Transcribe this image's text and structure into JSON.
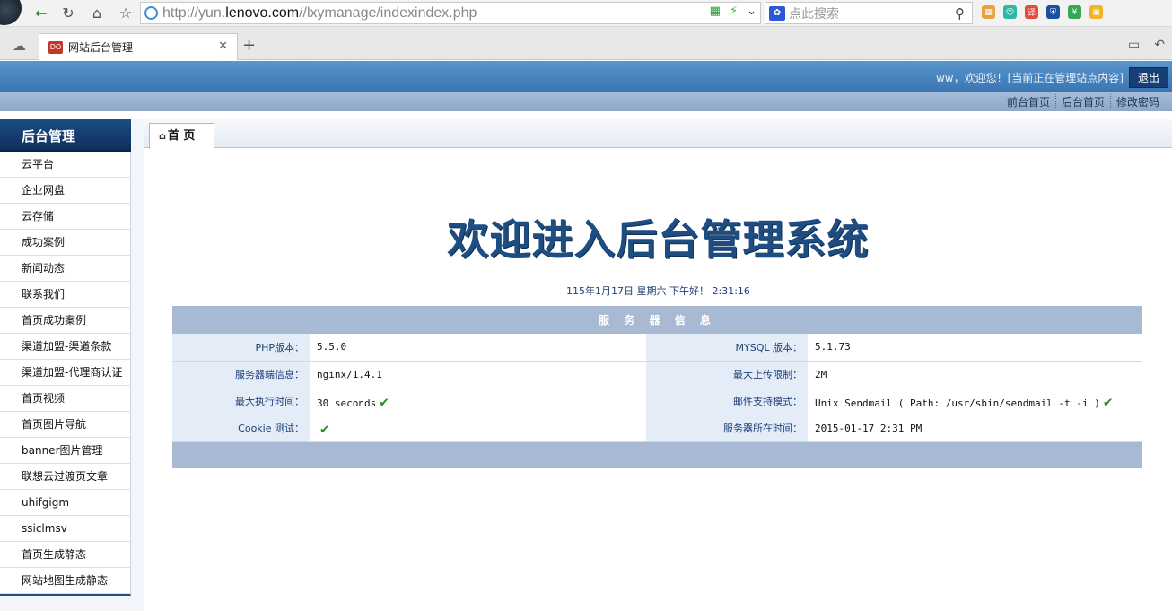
{
  "browser": {
    "url_prefix": "http://yun.",
    "url_host": "lenovo.com",
    "url_path": "//lxymanage/indexindex.php",
    "search_placeholder": "点此搜索",
    "tab_title": "网站后台管理",
    "favicon_text": "DO"
  },
  "header": {
    "welcome": "ww，欢迎您！[当前正在管理站点内容]",
    "logout_label": "退出"
  },
  "topnav": [
    "前台首页",
    "后台首页",
    "修改密码"
  ],
  "sidebar": {
    "title": "后台管理",
    "items": [
      "云平台",
      "企业网盘",
      "云存储",
      "成功案例",
      "新闻动态",
      "联系我们",
      "首页成功案例",
      "渠道加盟-渠道条款",
      "渠道加盟-代理商认证",
      "首页视频",
      "首页图片导航",
      "banner图片管理",
      "联想云过渡页文章",
      "uhifgigm",
      "ssiclmsv",
      "首页生成静态",
      "网站地图生成静态"
    ]
  },
  "main": {
    "tab_label": "首 页",
    "welcome_title": "欢迎进入后台管理系统",
    "datetime": "115年1月17日 星期六 下午好！ 2:31:16",
    "server_info_title": "服 务 器 信 息",
    "rows": [
      {
        "l1": "PHP版本：",
        "v1": "5.5.0",
        "l2": "MYSQL 版本：",
        "v2": "5.1.73"
      },
      {
        "l1": "服务器端信息：",
        "v1": "nginx/1.4.1",
        "l2": "最大上传限制：",
        "v2": "2M"
      },
      {
        "l1": "最大执行时间：",
        "v1": "30 seconds",
        "l2": "邮件支持模式：",
        "v2": "Unix Sendmail ( Path: /usr/sbin/sendmail -t -i )"
      },
      {
        "l1": "Cookie 测试：",
        "v1": "",
        "l2": "服务器所在时间：",
        "v2": "2015-01-17 2:31 PM"
      }
    ]
  }
}
